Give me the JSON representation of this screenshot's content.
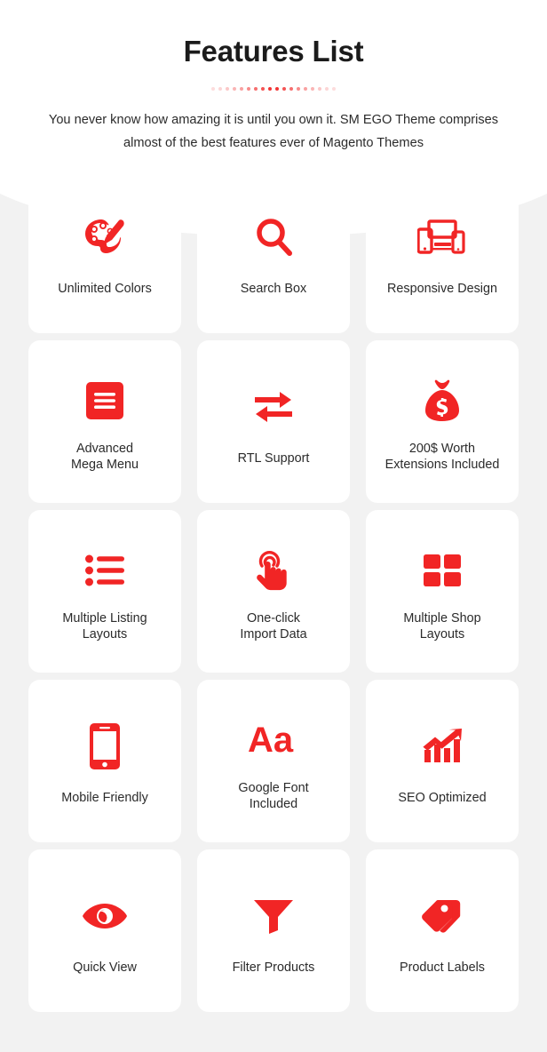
{
  "header": {
    "title": "Features List",
    "subtitle": "You never know how amazing it is until you own it. SM EGO Theme comprises almost of the best features ever of Magento Themes",
    "divider": {
      "icon": "dots-divider",
      "dot_count": 18,
      "accent_color": "#f12525"
    }
  },
  "theme": {
    "accent_color": "#f12525",
    "card_background": "#ffffff",
    "page_background": "#f2f2f2",
    "text_color": "#2b2b2b",
    "title_color": "#1b1b1b"
  },
  "features": [
    {
      "label": "Unlimited Colors",
      "icon": "palette-icon"
    },
    {
      "label": "Search Box",
      "icon": "search-icon"
    },
    {
      "label": "Responsive Design",
      "icon": "responsive-devices-icon"
    },
    {
      "label": "Advanced\nMega Menu",
      "icon": "hamburger-menu-icon"
    },
    {
      "label": "RTL Support",
      "icon": "arrows-exchange-icon"
    },
    {
      "label": "200$ Worth\nExtensions Included",
      "icon": "money-bag-icon"
    },
    {
      "label": "Multiple Listing\nLayouts",
      "icon": "bullet-list-icon"
    },
    {
      "label": "One-click\nImport Data",
      "icon": "hand-click-icon"
    },
    {
      "label": "Multiple Shop\nLayouts",
      "icon": "grid-squares-icon"
    },
    {
      "label": "Mobile Friendly",
      "icon": "mobile-phone-icon"
    },
    {
      "label": "Google Font\nIncluded",
      "icon": "typography-aa-icon"
    },
    {
      "label": "SEO Optimized",
      "icon": "growth-chart-icon"
    },
    {
      "label": "Quick View",
      "icon": "eye-icon"
    },
    {
      "label": "Filter Products",
      "icon": "funnel-filter-icon"
    },
    {
      "label": "Product Labels",
      "icon": "price-tags-icon"
    }
  ]
}
